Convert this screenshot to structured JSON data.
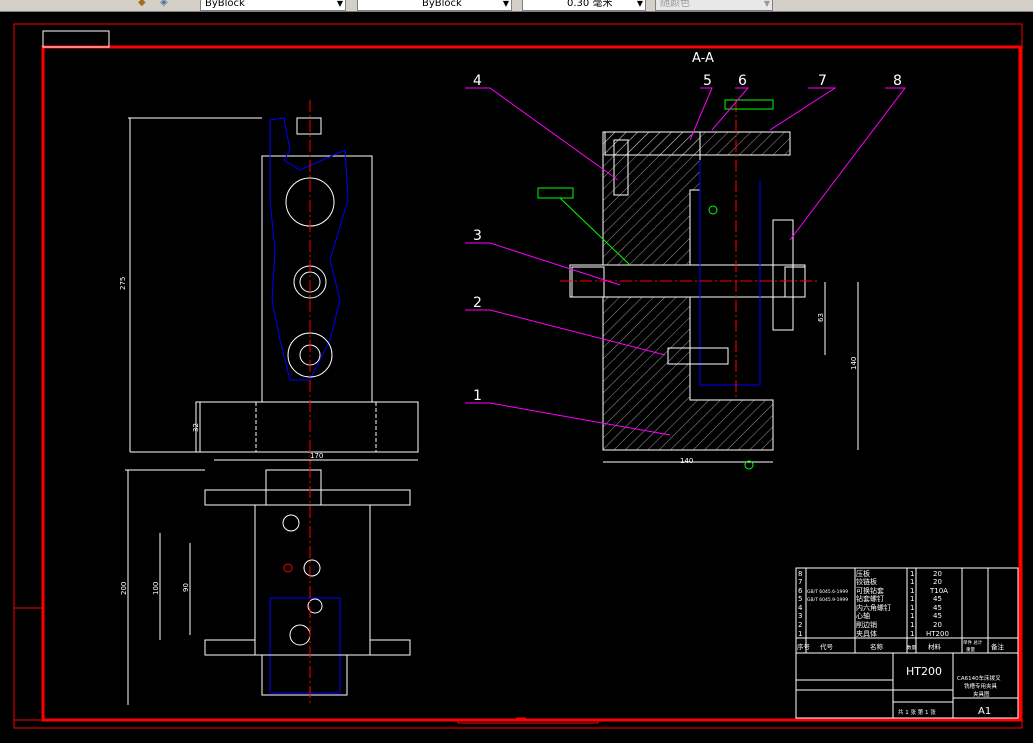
{
  "toolbar": {
    "linetype": "ByBlock",
    "lineweight_type": "ByBlock",
    "lineweight": "0.30 毫米",
    "color": "随颜色"
  },
  "drawing": {
    "section_label": "A-A",
    "balloons": [
      "1",
      "2",
      "3",
      "4",
      "5",
      "6",
      "7",
      "8"
    ],
    "dims": {
      "height_275": "275",
      "base_32": "32",
      "width_170": "170",
      "top_200": "200",
      "top_100": "100",
      "top_90": "90",
      "sec_140w": "140",
      "sec_140h": "140",
      "sec_63": "63"
    },
    "parts": [
      {
        "no": "8",
        "code": "",
        "name": "压板",
        "qty": "1",
        "material": "20"
      },
      {
        "no": "7",
        "code": "",
        "name": "铰链板",
        "qty": "1",
        "material": "20"
      },
      {
        "no": "6",
        "code": "GB/T 6045.6-1999",
        "name": "可换钻套",
        "qty": "1",
        "material": "T10A"
      },
      {
        "no": "5",
        "code": "GB/T 6045.9-1999",
        "name": "钻套螺钉",
        "qty": "1",
        "material": "45"
      },
      {
        "no": "4",
        "code": "",
        "name": "内六角螺钉",
        "qty": "1",
        "material": "45"
      },
      {
        "no": "3",
        "code": "",
        "name": "心轴",
        "qty": "1",
        "material": "45"
      },
      {
        "no": "2",
        "code": "",
        "name": "削边销",
        "qty": "1",
        "material": "20"
      },
      {
        "no": "1",
        "code": "",
        "name": "夹具体",
        "qty": "1",
        "material": "HT200"
      }
    ],
    "headers": {
      "no": "序号",
      "code": "代号",
      "name": "名称",
      "qty": "数量",
      "material": "材料",
      "weight1": "单件 总计",
      "weight2": "重量",
      "remark": "备注"
    },
    "title": {
      "material": "HT200",
      "name1": "CA6140车床拨叉",
      "name2": "铣槽专用夹具",
      "name3": "夹具图",
      "sheets": "共 1 张 第 1 张",
      "size": "A1"
    }
  }
}
